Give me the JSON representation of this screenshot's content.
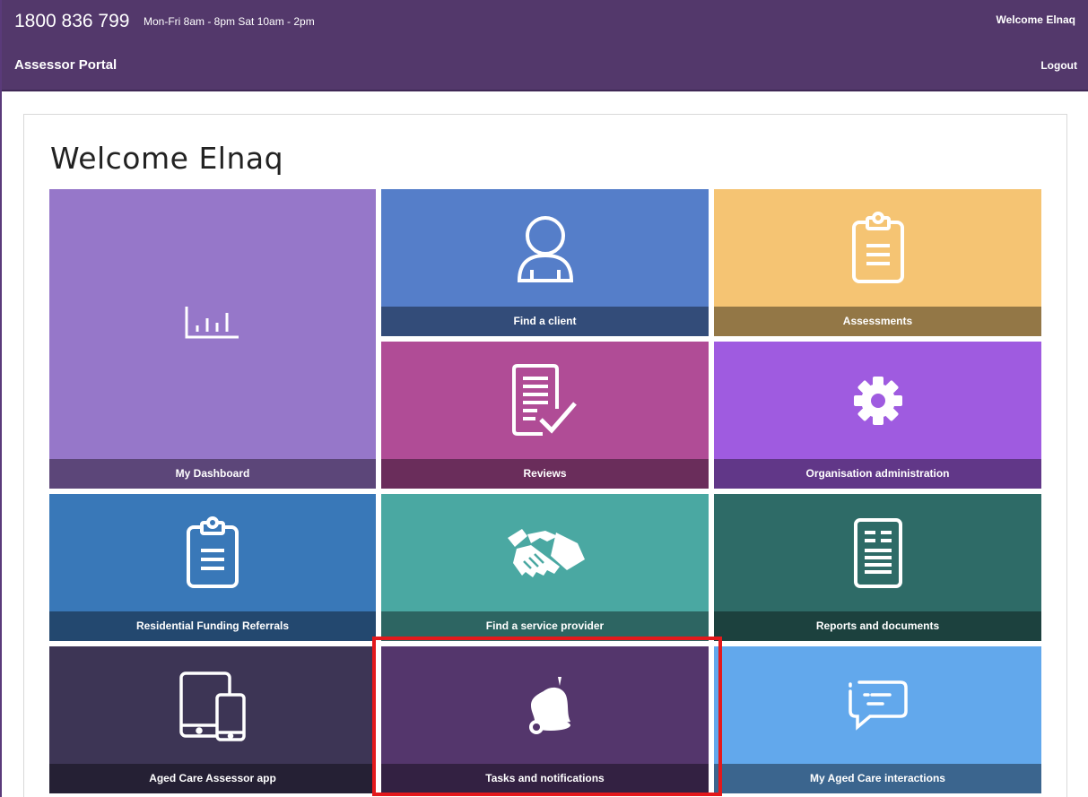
{
  "header": {
    "phone": "1800 836 799",
    "hours": "Mon-Fri 8am - 8pm Sat 10am - 2pm",
    "welcome": "Welcome Elnaq",
    "portal_title": "Assessor Portal",
    "logout": "Logout"
  },
  "main": {
    "welcome_heading": "Welcome Elnaq"
  },
  "tiles": [
    {
      "id": "my-dashboard",
      "label": "My Dashboard",
      "icon": "bar-chart-icon",
      "color": "#9677c9",
      "label_bg": "#5c4679"
    },
    {
      "id": "find-a-client",
      "label": "Find a client",
      "icon": "user-icon",
      "color": "#557ec9",
      "label_bg": "#334c79"
    },
    {
      "id": "assessments",
      "label": "Assessments",
      "icon": "clipboard-icon",
      "color": "#f5c473",
      "label_bg": "#937746"
    },
    {
      "id": "reviews",
      "label": "Reviews",
      "icon": "document-check-icon",
      "color": "#b04c96",
      "label_bg": "#6a2d5b"
    },
    {
      "id": "organisation-administration",
      "label": "Organisation administration",
      "icon": "gear-icon",
      "color": "#9f5be0",
      "label_bg": "#613788"
    },
    {
      "id": "residential-funding-referrals",
      "label": "Residential Funding Referrals",
      "icon": "clipboard-icon",
      "color": "#3978b8",
      "label_bg": "#23486f"
    },
    {
      "id": "find-a-service-provider",
      "label": "Find a service provider",
      "icon": "handshake-icon",
      "color": "#4aa8a2",
      "label_bg": "#2d6562"
    },
    {
      "id": "reports-and-documents",
      "label": "Reports and documents",
      "icon": "document-icon",
      "color": "#2e6b67",
      "label_bg": "#1c413e"
    },
    {
      "id": "aged-care-assessor-app",
      "label": "Aged Care Assessor app",
      "icon": "tablet-phone-icon",
      "color": "#3d3555",
      "label_bg": "#252034"
    },
    {
      "id": "tasks-and-notifications",
      "label": "Tasks and notifications",
      "icon": "bell-icon",
      "color": "#54366c",
      "label_bg": "#332142"
    },
    {
      "id": "my-aged-care-interactions",
      "label": "My Aged Care interactions",
      "icon": "chat-icon",
      "color": "#62a8ec",
      "label_bg": "#3b658e"
    }
  ],
  "highlight_color": "#e3191c"
}
